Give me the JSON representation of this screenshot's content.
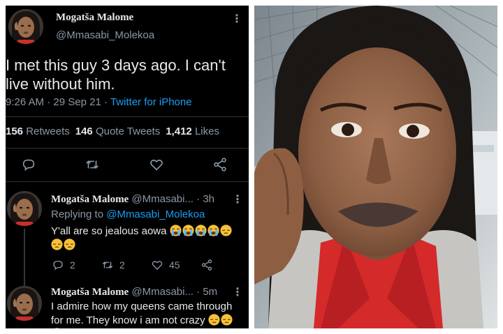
{
  "tweet": {
    "author_name": "Mogatša Malome",
    "author_handle": "@Mmasabi_Molekoa",
    "text": "I met this guy 3 days ago. I can't live without him.",
    "time": "9:26 AM",
    "date": "29 Sep 21",
    "separator": " · ",
    "source": "Twitter for iPhone",
    "retweets_count": "156",
    "retweets_label": "Retweets",
    "quote_count": "146",
    "quote_label": "Quote Tweets",
    "likes_count": "1,412",
    "likes_label": "Likes"
  },
  "replies": [
    {
      "name": "Mogatša Malome",
      "handle": "@Mmasabi...",
      "time": "· 3h",
      "replying_prefix": "Replying to",
      "replying_to": "@Mmasabi_Molekoa",
      "text": "Y'all are so jealous aowa",
      "emojis": [
        "crying-face",
        "crying-face",
        "crying-face",
        "crying-face",
        "pensive-face",
        "pensive-face",
        "pensive-face"
      ],
      "reply_count": "2",
      "retweet_count": "2",
      "like_count": "45"
    },
    {
      "name": "Mogatša Malome",
      "handle": "@Mmasabi...",
      "time": "· 5m",
      "text": "I admire how my queens came through for me. They know i am not crazy",
      "emojis": [
        "pensive-face",
        "pensive-face",
        "pensive-face"
      ]
    }
  ],
  "colors": {
    "background": "#000000",
    "primary_text": "#e7e9ea",
    "secondary_text": "#8b98a5",
    "link": "#1d9bf0",
    "divider": "#2f3336"
  },
  "icons": [
    "more-icon",
    "reply-icon",
    "retweet-icon",
    "like-icon",
    "share-icon"
  ]
}
